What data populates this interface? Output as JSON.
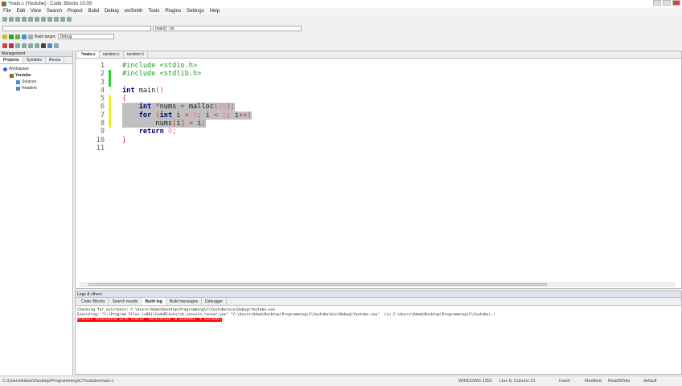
{
  "window": {
    "title": "*main.c [Youtube] - Code::Blocks 10.05"
  },
  "menu": [
    "File",
    "Edit",
    "View",
    "Search",
    "Project",
    "Build",
    "Debug",
    "wxSmith",
    "Tools",
    "Plugins",
    "Settings",
    "Help"
  ],
  "toolbar": {
    "scope_value": "",
    "function_value": "main() : int",
    "build_target_label": "Build target:",
    "build_target_value": "Debug"
  },
  "management": {
    "title": "Management",
    "tabs": [
      "Projects",
      "Symbols",
      "Resou"
    ],
    "tree": [
      "Workspace",
      "Youtube",
      "Sources",
      "Headers"
    ]
  },
  "editor": {
    "tabs": [
      "*main.c",
      "random.c",
      "random.h"
    ],
    "lines": [
      [
        [
          "pp",
          "#include <stdio.h>"
        ]
      ],
      [
        [
          "pp",
          "#include <stdlib.h>"
        ]
      ],
      [],
      [
        [
          "kw",
          "int"
        ],
        [
          "id",
          " main"
        ],
        [
          "op",
          "()"
        ]
      ],
      [
        [
          "op",
          "{"
        ]
      ],
      [
        [
          "id",
          "    "
        ],
        [
          "kw",
          "int"
        ],
        [
          "op",
          " *"
        ],
        [
          "id",
          "nums "
        ],
        [
          "op",
          "="
        ],
        [
          "id",
          " malloc"
        ],
        [
          "op",
          "("
        ],
        [
          "nm",
          "20"
        ],
        [
          "op",
          ");"
        ]
      ],
      [
        [
          "id",
          "    "
        ],
        [
          "kw",
          "for"
        ],
        [
          "op",
          " ("
        ],
        [
          "kw",
          "int"
        ],
        [
          "id",
          " i "
        ],
        [
          "op",
          "="
        ],
        [
          "nm",
          " 0"
        ],
        [
          "op",
          ";"
        ],
        [
          "id",
          " i "
        ],
        [
          "op",
          "<"
        ],
        [
          "nm",
          " 5"
        ],
        [
          "op",
          ";"
        ],
        [
          "id",
          " i"
        ],
        [
          "op",
          "++)"
        ]
      ],
      [
        [
          "id",
          "        nums"
        ],
        [
          "op",
          "["
        ],
        [
          "id",
          "i"
        ],
        [
          "op",
          "]"
        ],
        [
          "id",
          " "
        ],
        [
          "op",
          "="
        ],
        [
          "id",
          " i"
        ],
        [
          "op",
          ";"
        ]
      ],
      [
        [
          "id",
          "    "
        ],
        [
          "kw",
          "return"
        ],
        [
          "nm",
          " 0"
        ],
        [
          "op",
          ";"
        ]
      ],
      [
        [
          "op",
          "}"
        ]
      ],
      []
    ]
  },
  "logs": {
    "title": "Logs & others",
    "tabs": [
      "Code::Blocks",
      "Search results",
      "Build log",
      "Build messages",
      "Debugger"
    ],
    "lines": [
      "Checking for existence: C:\\Users\\Adam\\Desktop\\Programming\\C\\Youtube\\bin\\Debug\\Youtube.exe",
      "Executing: \"C:\\Program Files (x86)\\CodeBlocks/cb_console_runner.exe\" \"C:\\Users\\Adam\\Desktop\\Programming\\C\\Youtube\\bin\\Debug\\Youtube.exe\"  (in C:\\Users\\Adam\\Desktop\\Programming\\C\\Youtube\\.)",
      "Process terminated with status -1073741510 (0 minutes, 4 seconds)"
    ]
  },
  "status": {
    "path": "C:\\Users\\Adam\\Desktop\\Programming\\C\\Youtube\\main.c",
    "encoding": "WINDOWS-1252",
    "position": "Line 8, Column 21",
    "mode": "Insert",
    "modified": "Modified",
    "access": "Read/Write",
    "profile": "default"
  }
}
